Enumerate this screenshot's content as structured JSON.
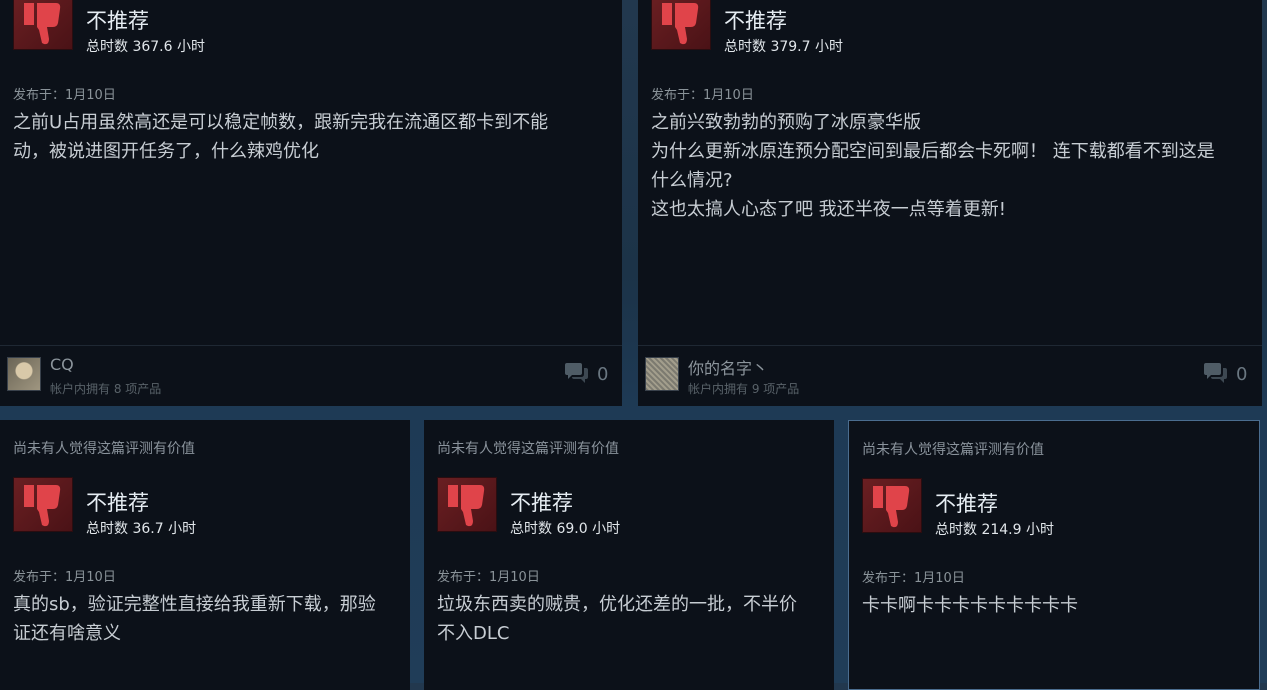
{
  "reviews": [
    {
      "rec": "不推荐",
      "hours": "总时数 367.6 小时",
      "posted": "发布于：1月10日",
      "lines": [
        "之前U占用虽然高还是可以稳定帧数，跟新完我在流通区都卡到不能",
        "动，被说进图开任务了，什么辣鸡优化"
      ],
      "user": "CQ",
      "owned": "帐户内拥有 8 项产品",
      "comments": "0"
    },
    {
      "rec": "不推荐",
      "hours": "总时数 379.7 小时",
      "posted": "发布于：1月10日",
      "lines": [
        "之前兴致勃勃的预购了冰原豪华版",
        "为什么更新冰原连预分配空间到最后都会卡死啊！ 连下载都看不到这是",
        "什么情况?",
        "这也太搞人心态了吧 我还半夜一点等着更新!"
      ],
      "user": "你的名字丶",
      "owned": "帐户内拥有 9 项产品",
      "comments": "0"
    },
    {
      "helpful": "尚未有人觉得这篇评测有价值",
      "rec": "不推荐",
      "hours": "总时数 36.7 小时",
      "posted": "发布于：1月10日",
      "lines": [
        "真的sb，验证完整性直接给我重新下载，那验",
        "证还有啥意义"
      ]
    },
    {
      "helpful": "尚未有人觉得这篇评测有价值",
      "rec": "不推荐",
      "hours": "总时数 69.0 小时",
      "posted": "发布于：1月10日",
      "lines": [
        "垃圾东西卖的贼贵，优化还差的一批，不半价",
        "不入DLC"
      ]
    },
    {
      "helpful": "尚未有人觉得这篇评测有价值",
      "rec": "不推荐",
      "hours": "总时数 214.9 小时",
      "posted": "发布于：1月10日",
      "lines": [
        "卡卡啊卡卡卡卡卡卡卡卡卡"
      ]
    }
  ],
  "icons": {
    "thumbs_down": "thumbs-down-icon",
    "comment": "comment-icon"
  },
  "colors": {
    "page_bg": "#1d3449",
    "card_bg": "#0c1119",
    "thumb_bg": "#5b181c",
    "thumb_fg": "#e0444a",
    "selected_border": "#4b6d8f"
  }
}
